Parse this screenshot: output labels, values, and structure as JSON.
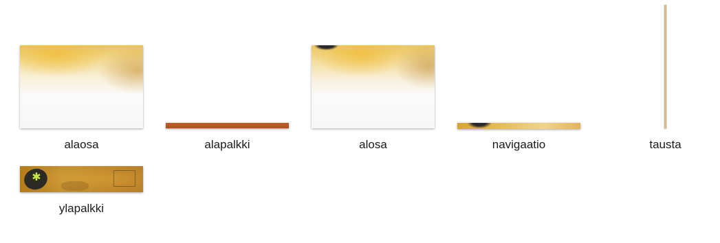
{
  "files": [
    {
      "name": "alaosa"
    },
    {
      "name": "alapalkki"
    },
    {
      "name": "alosa"
    },
    {
      "name": "navigaatio"
    },
    {
      "name": "tausta"
    },
    {
      "name": "ylapalkki"
    }
  ],
  "colors": {
    "background": "#ffffff",
    "label_text": "#1a1a1a",
    "alapalkki_bar": "#c15a28",
    "gold_accent": "#e9c25a"
  }
}
